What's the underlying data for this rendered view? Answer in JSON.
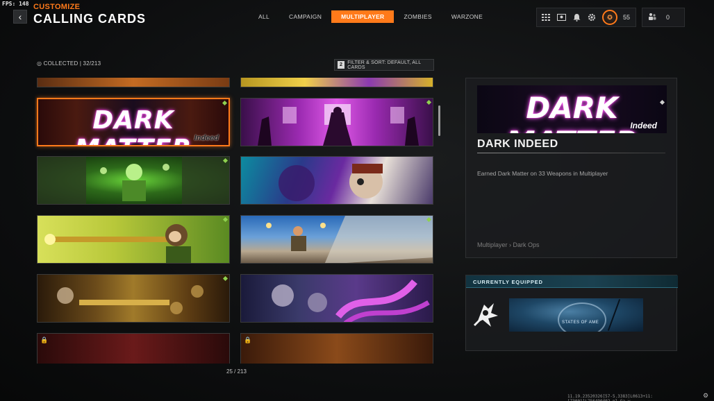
{
  "fps": "FPS: 148",
  "header": {
    "subtitle": "CUSTOMIZE",
    "title": "CALLING CARDS",
    "back_icon": "chevron-left-icon",
    "tabs": [
      {
        "label": "ALL",
        "active": false
      },
      {
        "label": "CAMPAIGN",
        "active": false
      },
      {
        "label": "MULTIPLAYER",
        "active": true
      },
      {
        "label": "ZOMBIES",
        "active": false
      },
      {
        "label": "WARZONE",
        "active": false
      }
    ],
    "top_icons": [
      "grid-icon",
      "id-card-icon",
      "bell-icon",
      "gear-icon"
    ],
    "level": "55",
    "friends_count": "0"
  },
  "collection": {
    "collected": "COLLECTED | 32/213",
    "filter_key": "2",
    "filter_label": "FILTER & SORT: DEFAULT, ALL CARDS",
    "page_count": "25 / 213"
  },
  "cards": [
    {
      "id": "partial-top-left",
      "locked": false,
      "marker": false,
      "selected": false
    },
    {
      "id": "partial-top-right",
      "locked": false,
      "marker": false,
      "selected": false
    },
    {
      "id": "dark-matter",
      "title": "DARK MATTER",
      "subtitle": "Indeed",
      "locked": false,
      "marker": true,
      "selected": true
    },
    {
      "id": "ninja-dojo",
      "locked": false,
      "marker": true,
      "selected": false
    },
    {
      "id": "toxic-skeleton",
      "locked": false,
      "marker": true,
      "selected": false
    },
    {
      "id": "cyborg-face",
      "locked": false,
      "marker": false,
      "selected": false
    },
    {
      "id": "monkey-gunner",
      "locked": false,
      "marker": true,
      "selected": false
    },
    {
      "id": "soldier-dive",
      "locked": false,
      "marker": true,
      "selected": false
    },
    {
      "id": "gold-skulls",
      "locked": false,
      "marker": true,
      "selected": false
    },
    {
      "id": "purple-skulls",
      "locked": false,
      "marker": false,
      "selected": false
    },
    {
      "id": "ranked-play",
      "locked": true,
      "marker": false,
      "selected": false
    },
    {
      "id": "ranked-play-top",
      "locked": true,
      "marker": false,
      "selected": false
    }
  ],
  "detail": {
    "card_title": "DARK MATTER",
    "card_subtitle": "Indeed",
    "name": "DARK INDEED",
    "description": "Earned Dark Matter on 33 Weapons in Multiplayer",
    "path": "Multiplayer › Dark Ops"
  },
  "equipped": {
    "header": "CURRENTLY EQUIPPED",
    "card_text": "STATES OF AME"
  },
  "footer": "11.19.23520326[57-5.3383]L0613+11:[73001]L756490402.pl.Ga.w"
}
